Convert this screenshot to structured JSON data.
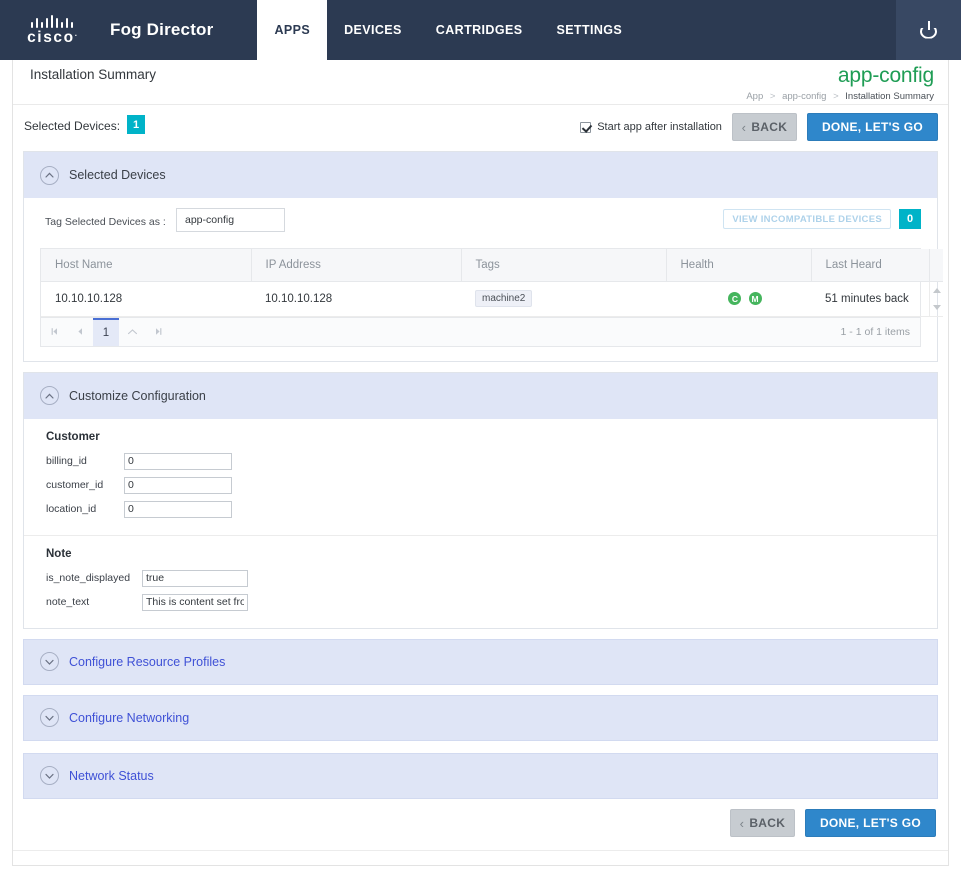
{
  "navbar": {
    "brand_name": "Fog Director",
    "logo_name": "cisco",
    "logo_registered": ".",
    "tabs": [
      {
        "label": "APPS",
        "active": true
      },
      {
        "label": "DEVICES",
        "active": false
      },
      {
        "label": "CARTRIDGES",
        "active": false
      },
      {
        "label": "SETTINGS",
        "active": false
      }
    ],
    "power_icon": "power-icon"
  },
  "page_head": {
    "title": "Installation Summary",
    "app_title": "app-config",
    "breadcrumb": {
      "items": [
        "App",
        "app-config",
        "Installation Summary"
      ],
      "separator": ">"
    }
  },
  "toolbar": {
    "selected_devices_label": "Selected Devices:",
    "selected_devices_count": "1",
    "start_app_label": "Start app after installation",
    "start_app_checked": true,
    "back_label": "BACK",
    "back_chevron": "‹",
    "primary_label": "DONE, LET'S GO"
  },
  "selected_devices_panel": {
    "header": "Selected Devices",
    "expanded": true,
    "tag_label": "Tag Selected Devices as :",
    "tag_value": "app-config",
    "tag_placeholder": "",
    "view_incompatible_label": "VIEW INCOMPATIBLE DEVICES",
    "view_incompatible_count": "0",
    "table": {
      "columns": [
        "Host Name",
        "IP Address",
        "Tags",
        "Health",
        "Last Heard"
      ],
      "rows": [
        {
          "host_name": "10.10.10.128",
          "ip_address": "10.10.10.128",
          "tags": [
            "machine2"
          ],
          "health": [
            "C",
            "M"
          ],
          "last_heard": "51 minutes back"
        }
      ]
    },
    "pagination": {
      "first": "⏮",
      "prev": "◀",
      "current_page": "1",
      "next": "˄",
      "last": "⏭",
      "info": "1 - 1 of 1 items"
    }
  },
  "customize_configuration": {
    "header": "Customize Configuration",
    "expanded": true,
    "groups": [
      {
        "title": "Customer",
        "fields": [
          {
            "key": "billing_id",
            "value": "0"
          },
          {
            "key": "customer_id",
            "value": "0"
          },
          {
            "key": "location_id",
            "value": "0"
          }
        ]
      },
      {
        "title": "Note",
        "fields": [
          {
            "key": "is_note_displayed",
            "value": "true"
          },
          {
            "key": "note_text",
            "value": "This is content set from t"
          }
        ]
      }
    ]
  },
  "collapsed_panels": [
    {
      "header": "Configure Resource Profiles"
    },
    {
      "header": "Configure Networking"
    },
    {
      "header": "Network Status"
    }
  ],
  "bottom_bar": {
    "back_label": "BACK",
    "back_chevron": "‹",
    "primary_label": "DONE, LET'S GO"
  },
  "colors": {
    "navbar_bg": "#2c3a52",
    "accent_teal": "#00b3c8",
    "accent_green": "#1f9d55",
    "primary_blue": "#2f87cb",
    "panel_blue": "#dfe5f6",
    "health_green": "#45b55d",
    "link_blue": "#3f51d6"
  }
}
